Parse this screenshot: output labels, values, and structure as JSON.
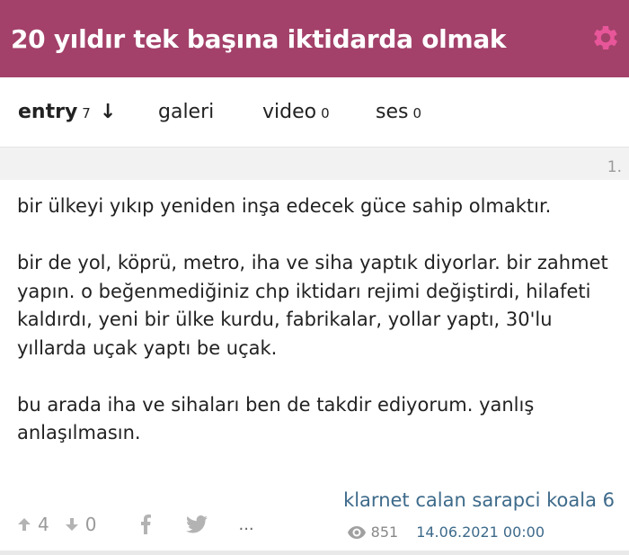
{
  "header": {
    "title": "20 yıldır tek başına iktidarda olmak",
    "settings_icon": "gear-icon",
    "bg_color": "#a3416a"
  },
  "tabs": [
    {
      "label": "entry",
      "count": "7",
      "active": true
    },
    {
      "label": "galeri",
      "count": ""
    },
    {
      "label": "video",
      "count": "0"
    },
    {
      "label": "ses",
      "count": "0"
    }
  ],
  "entry": {
    "number": "1.",
    "paragraphs": [
      "bir ülkeyi yıkıp yeniden inşa edecek güce sahip olmaktır.",
      "bir de yol, köprü, metro, iha ve siha yaptık diyorlar. bir zahmet yapın. o beğenmediğiniz chp iktidarı rejimi değiştirdi, hilafeti kaldırdı, yeni bir ülke kurdu, fabrikalar, yollar yaptı, 30'lu yıllarda uçak yaptı be uçak.",
      "bu arada iha ve sihaları ben de takdir ediyorum. yanlış anlaşılmasın."
    ],
    "author": "klarnet calan sarapci koala 6",
    "upvotes": "4",
    "downvotes": "0",
    "views": "851",
    "date": "14.06.2021 00:00",
    "more": "..."
  }
}
